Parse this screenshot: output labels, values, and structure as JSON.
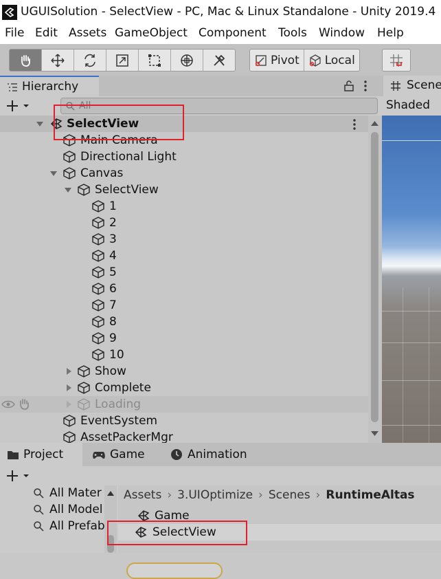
{
  "window": {
    "title": "UGUISolution - SelectView - PC, Mac & Linux Standalone - Unity 2019.4"
  },
  "menu": [
    "File",
    "Edit",
    "Assets",
    "GameObject",
    "Component",
    "Tools",
    "Window",
    "Help"
  ],
  "toolbar": {
    "pivot_label": "Pivot",
    "local_label": "Local"
  },
  "hierarchy": {
    "tab_label": "Hierarchy",
    "search_placeholder": "All",
    "scene_name": "SelectView",
    "items": [
      {
        "name": "Main Camera"
      },
      {
        "name": "Directional Light"
      },
      {
        "name": "Canvas"
      },
      {
        "name": "SelectView"
      },
      {
        "name": "1"
      },
      {
        "name": "2"
      },
      {
        "name": "3"
      },
      {
        "name": "4"
      },
      {
        "name": "5"
      },
      {
        "name": "6"
      },
      {
        "name": "7"
      },
      {
        "name": "8"
      },
      {
        "name": "9"
      },
      {
        "name": "10"
      },
      {
        "name": "Show"
      },
      {
        "name": "Complete"
      },
      {
        "name": "Loading"
      },
      {
        "name": "EventSystem"
      },
      {
        "name": "AssetPackerMgr"
      }
    ]
  },
  "scene": {
    "tab_label": "Scene",
    "shading_mode": "Shaded"
  },
  "bottom_tabs": {
    "project": "Project",
    "game": "Game",
    "animation": "Animation"
  },
  "project": {
    "favorites": [
      "All Mater",
      "All Model",
      "All Prefab"
    ],
    "breadcrumb": [
      "Assets",
      "3.UIOptimize",
      "Scenes",
      "RuntimeAltas"
    ],
    "assets": [
      "Game",
      "SelectView"
    ]
  },
  "colors": {
    "highlight_box": "#e0202a",
    "selected_outline": "#c8a84a",
    "tab_accent": "#3a72c9"
  }
}
